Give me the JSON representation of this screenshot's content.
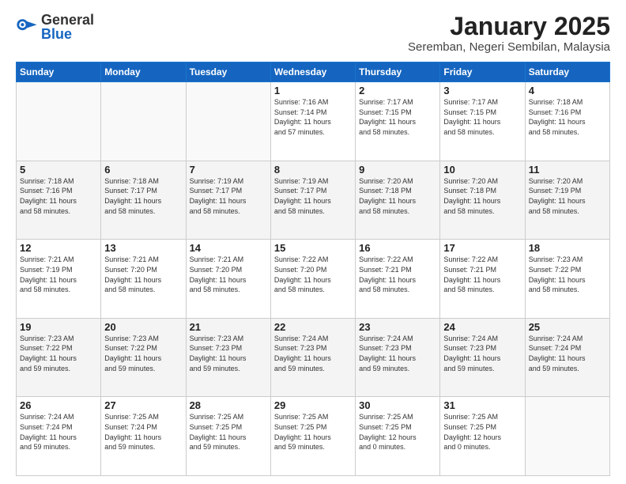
{
  "header": {
    "logo_general": "General",
    "logo_blue": "Blue",
    "title": "January 2025",
    "subtitle": "Seremban, Negeri Sembilan, Malaysia"
  },
  "weekdays": [
    "Sunday",
    "Monday",
    "Tuesday",
    "Wednesday",
    "Thursday",
    "Friday",
    "Saturday"
  ],
  "weeks": [
    [
      {
        "day": "",
        "info": ""
      },
      {
        "day": "",
        "info": ""
      },
      {
        "day": "",
        "info": ""
      },
      {
        "day": "1",
        "info": "Sunrise: 7:16 AM\nSunset: 7:14 PM\nDaylight: 11 hours\nand 57 minutes."
      },
      {
        "day": "2",
        "info": "Sunrise: 7:17 AM\nSunset: 7:15 PM\nDaylight: 11 hours\nand 58 minutes."
      },
      {
        "day": "3",
        "info": "Sunrise: 7:17 AM\nSunset: 7:15 PM\nDaylight: 11 hours\nand 58 minutes."
      },
      {
        "day": "4",
        "info": "Sunrise: 7:18 AM\nSunset: 7:16 PM\nDaylight: 11 hours\nand 58 minutes."
      }
    ],
    [
      {
        "day": "5",
        "info": "Sunrise: 7:18 AM\nSunset: 7:16 PM\nDaylight: 11 hours\nand 58 minutes."
      },
      {
        "day": "6",
        "info": "Sunrise: 7:18 AM\nSunset: 7:17 PM\nDaylight: 11 hours\nand 58 minutes."
      },
      {
        "day": "7",
        "info": "Sunrise: 7:19 AM\nSunset: 7:17 PM\nDaylight: 11 hours\nand 58 minutes."
      },
      {
        "day": "8",
        "info": "Sunrise: 7:19 AM\nSunset: 7:17 PM\nDaylight: 11 hours\nand 58 minutes."
      },
      {
        "day": "9",
        "info": "Sunrise: 7:20 AM\nSunset: 7:18 PM\nDaylight: 11 hours\nand 58 minutes."
      },
      {
        "day": "10",
        "info": "Sunrise: 7:20 AM\nSunset: 7:18 PM\nDaylight: 11 hours\nand 58 minutes."
      },
      {
        "day": "11",
        "info": "Sunrise: 7:20 AM\nSunset: 7:19 PM\nDaylight: 11 hours\nand 58 minutes."
      }
    ],
    [
      {
        "day": "12",
        "info": "Sunrise: 7:21 AM\nSunset: 7:19 PM\nDaylight: 11 hours\nand 58 minutes."
      },
      {
        "day": "13",
        "info": "Sunrise: 7:21 AM\nSunset: 7:20 PM\nDaylight: 11 hours\nand 58 minutes."
      },
      {
        "day": "14",
        "info": "Sunrise: 7:21 AM\nSunset: 7:20 PM\nDaylight: 11 hours\nand 58 minutes."
      },
      {
        "day": "15",
        "info": "Sunrise: 7:22 AM\nSunset: 7:20 PM\nDaylight: 11 hours\nand 58 minutes."
      },
      {
        "day": "16",
        "info": "Sunrise: 7:22 AM\nSunset: 7:21 PM\nDaylight: 11 hours\nand 58 minutes."
      },
      {
        "day": "17",
        "info": "Sunrise: 7:22 AM\nSunset: 7:21 PM\nDaylight: 11 hours\nand 58 minutes."
      },
      {
        "day": "18",
        "info": "Sunrise: 7:23 AM\nSunset: 7:22 PM\nDaylight: 11 hours\nand 58 minutes."
      }
    ],
    [
      {
        "day": "19",
        "info": "Sunrise: 7:23 AM\nSunset: 7:22 PM\nDaylight: 11 hours\nand 59 minutes."
      },
      {
        "day": "20",
        "info": "Sunrise: 7:23 AM\nSunset: 7:22 PM\nDaylight: 11 hours\nand 59 minutes."
      },
      {
        "day": "21",
        "info": "Sunrise: 7:23 AM\nSunset: 7:23 PM\nDaylight: 11 hours\nand 59 minutes."
      },
      {
        "day": "22",
        "info": "Sunrise: 7:24 AM\nSunset: 7:23 PM\nDaylight: 11 hours\nand 59 minutes."
      },
      {
        "day": "23",
        "info": "Sunrise: 7:24 AM\nSunset: 7:23 PM\nDaylight: 11 hours\nand 59 minutes."
      },
      {
        "day": "24",
        "info": "Sunrise: 7:24 AM\nSunset: 7:23 PM\nDaylight: 11 hours\nand 59 minutes."
      },
      {
        "day": "25",
        "info": "Sunrise: 7:24 AM\nSunset: 7:24 PM\nDaylight: 11 hours\nand 59 minutes."
      }
    ],
    [
      {
        "day": "26",
        "info": "Sunrise: 7:24 AM\nSunset: 7:24 PM\nDaylight: 11 hours\nand 59 minutes."
      },
      {
        "day": "27",
        "info": "Sunrise: 7:25 AM\nSunset: 7:24 PM\nDaylight: 11 hours\nand 59 minutes."
      },
      {
        "day": "28",
        "info": "Sunrise: 7:25 AM\nSunset: 7:25 PM\nDaylight: 11 hours\nand 59 minutes."
      },
      {
        "day": "29",
        "info": "Sunrise: 7:25 AM\nSunset: 7:25 PM\nDaylight: 11 hours\nand 59 minutes."
      },
      {
        "day": "30",
        "info": "Sunrise: 7:25 AM\nSunset: 7:25 PM\nDaylight: 12 hours\nand 0 minutes."
      },
      {
        "day": "31",
        "info": "Sunrise: 7:25 AM\nSunset: 7:25 PM\nDaylight: 12 hours\nand 0 minutes."
      },
      {
        "day": "",
        "info": ""
      }
    ]
  ]
}
